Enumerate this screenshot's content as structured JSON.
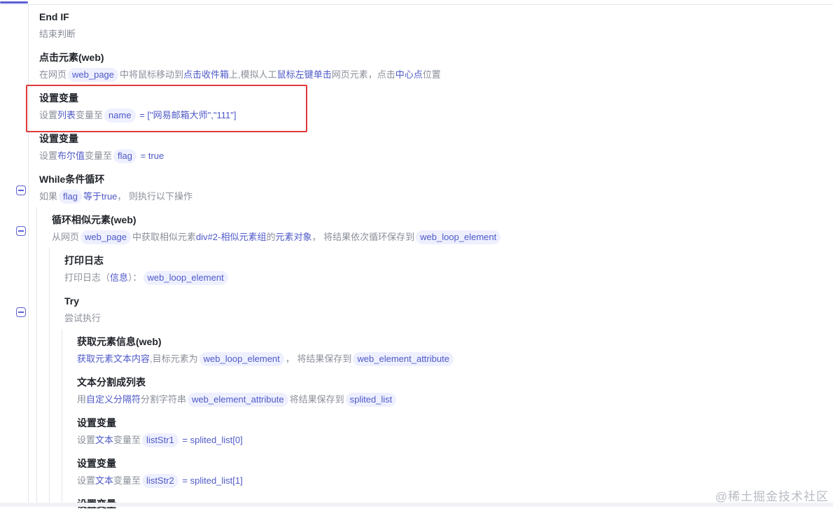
{
  "steps": [
    {
      "title": "End IF",
      "desc": [
        {
          "t": "text",
          "v": "结束判断"
        }
      ]
    },
    {
      "title": "点击元素(web)",
      "desc": [
        {
          "t": "text",
          "v": "在网页"
        },
        {
          "t": "pill",
          "v": "web_page"
        },
        {
          "t": "text",
          "v": "中将鼠标移动到"
        },
        {
          "t": "kw",
          "v": "点击收件箱"
        },
        {
          "t": "text",
          "v": "上,模拟人工"
        },
        {
          "t": "kw",
          "v": "鼠标左键"
        },
        {
          "t": "kw",
          "v": "单击"
        },
        {
          "t": "text",
          "v": "网页元素，点击"
        },
        {
          "t": "kw",
          "v": "中心点"
        },
        {
          "t": "text",
          "v": "位置"
        }
      ]
    },
    {
      "title": "设置变量",
      "desc": [
        {
          "t": "text",
          "v": "设置"
        },
        {
          "t": "kw",
          "v": "列表"
        },
        {
          "t": "text",
          "v": "变量至"
        },
        {
          "t": "pill",
          "v": "name"
        },
        {
          "t": "val",
          "v": " = [\"网易邮箱大师\",\"111\"]"
        }
      ]
    },
    {
      "title": "设置变量",
      "desc": [
        {
          "t": "text",
          "v": "设置"
        },
        {
          "t": "kw",
          "v": "布尔值"
        },
        {
          "t": "text",
          "v": "变量至"
        },
        {
          "t": "pill",
          "v": "flag"
        },
        {
          "t": "val",
          "v": " = true"
        }
      ]
    },
    {
      "title": "While条件循环",
      "desc": [
        {
          "t": "text",
          "v": "如果"
        },
        {
          "t": "pill",
          "v": "flag"
        },
        {
          "t": "kw",
          "v": "等于"
        },
        {
          "t": "val",
          "v": "true"
        },
        {
          "t": "text",
          "v": "，  则执行以下操作"
        }
      ]
    },
    {
      "title": "循环相似元素(web)",
      "desc": [
        {
          "t": "text",
          "v": "从网页"
        },
        {
          "t": "pill",
          "v": "web_page"
        },
        {
          "t": "text",
          "v": "中获取相似元素"
        },
        {
          "t": "kw",
          "v": "div#2-相似元素组"
        },
        {
          "t": "text",
          "v": "的"
        },
        {
          "t": "kw",
          "v": "元素对象"
        },
        {
          "t": "text",
          "v": "，  将结果依次循环保存到"
        },
        {
          "t": "pill",
          "v": "web_loop_element"
        }
      ]
    },
    {
      "title": "打印日志",
      "desc": [
        {
          "t": "text",
          "v": "打印日志（"
        },
        {
          "t": "kw",
          "v": "信息"
        },
        {
          "t": "text",
          "v": "）："
        },
        {
          "t": "pill",
          "v": "web_loop_element"
        }
      ]
    },
    {
      "title": "Try",
      "desc": [
        {
          "t": "text",
          "v": "尝试执行"
        }
      ]
    },
    {
      "title": "获取元素信息(web)",
      "desc": [
        {
          "t": "kw",
          "v": "获取元素文本内容"
        },
        {
          "t": "text",
          "v": ",目标元素为"
        },
        {
          "t": "pill",
          "v": "web_loop_element"
        },
        {
          "t": "text",
          "v": "，  将结果保存到"
        },
        {
          "t": "pill",
          "v": "web_element_attribute"
        }
      ]
    },
    {
      "title": "文本分割成列表",
      "desc": [
        {
          "t": "text",
          "v": "用"
        },
        {
          "t": "kw",
          "v": "自定义分隔符"
        },
        {
          "t": "text",
          "v": "分割字符串"
        },
        {
          "t": "pill",
          "v": "web_element_attribute"
        },
        {
          "t": "text",
          "v": "将结果保存到"
        },
        {
          "t": "pill",
          "v": "splited_list"
        }
      ]
    },
    {
      "title": "设置变量",
      "desc": [
        {
          "t": "text",
          "v": "设置"
        },
        {
          "t": "kw",
          "v": "文本"
        },
        {
          "t": "text",
          "v": "变量至"
        },
        {
          "t": "pill",
          "v": "listStr1"
        },
        {
          "t": "val",
          "v": " = splited_list[0]"
        }
      ]
    },
    {
      "title": "设置变量",
      "desc": [
        {
          "t": "text",
          "v": "设置"
        },
        {
          "t": "kw",
          "v": "文本"
        },
        {
          "t": "text",
          "v": "变量至"
        },
        {
          "t": "pill",
          "v": "listStr2"
        },
        {
          "t": "val",
          "v": " = splited_list[1]"
        }
      ]
    },
    {
      "title": "设置变量",
      "desc": []
    }
  ],
  "watermark": "@稀土掘金技术社区"
}
